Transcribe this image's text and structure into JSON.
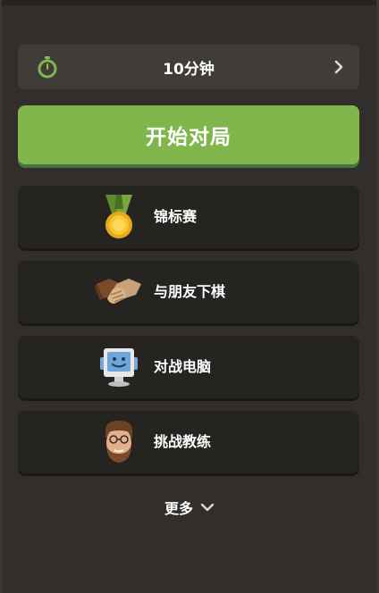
{
  "time_control": {
    "label": "10分钟",
    "icon": "stopwatch-icon",
    "accent": "#81b64c"
  },
  "play_button": {
    "label": "开始对局",
    "color": "#81b64c"
  },
  "modes": [
    {
      "label": "锦标赛",
      "icon": "medal-icon"
    },
    {
      "label": "与朋友下棋",
      "icon": "handshake-icon"
    },
    {
      "label": "对战电脑",
      "icon": "computer-icon"
    },
    {
      "label": "挑战教练",
      "icon": "coach-avatar-icon"
    }
  ],
  "more": {
    "label": "更多",
    "icon": "chevron-down-icon"
  }
}
